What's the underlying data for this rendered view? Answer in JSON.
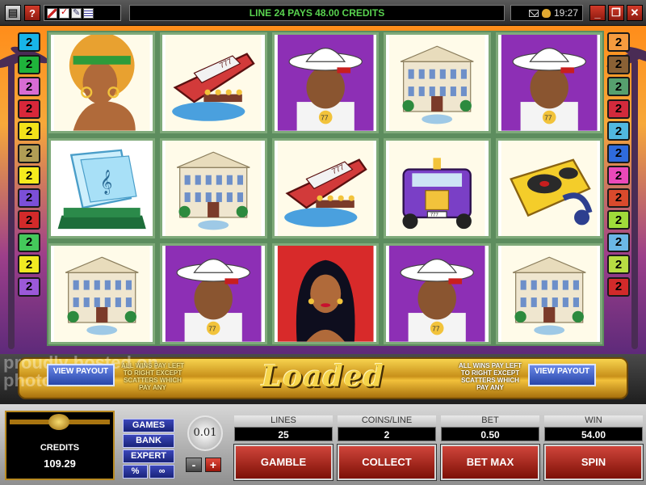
{
  "topbar": {
    "message": "LINE 24 PAYS 48.00 CREDITS",
    "time": "19:27",
    "help_label": "?"
  },
  "lines": {
    "left": [
      {
        "label": "2",
        "color": "#18b4e8"
      },
      {
        "label": "2",
        "color": "#1fb33b"
      },
      {
        "label": "2",
        "color": "#d86cd3"
      },
      {
        "label": "2",
        "color": "#d8273a"
      },
      {
        "label": "2",
        "color": "#f3e21a"
      },
      {
        "label": "2",
        "color": "#b19d55"
      },
      {
        "label": "2",
        "color": "#f6ec1d"
      },
      {
        "label": "2",
        "color": "#7b4fd8"
      },
      {
        "label": "2",
        "color": "#d22a2a"
      },
      {
        "label": "2",
        "color": "#44c95b"
      },
      {
        "label": "2",
        "color": "#f0ea22"
      },
      {
        "label": "2",
        "color": "#9b59d8"
      }
    ],
    "right": [
      {
        "label": "2",
        "color": "#f59b3e"
      },
      {
        "label": "2",
        "color": "#8a6135"
      },
      {
        "label": "2",
        "color": "#56a06e"
      },
      {
        "label": "2",
        "color": "#d22a3c"
      },
      {
        "label": "2",
        "color": "#50b8e0"
      },
      {
        "label": "2",
        "color": "#2f6bdc"
      },
      {
        "label": "2",
        "color": "#eb49b9"
      },
      {
        "label": "2",
        "color": "#d94a2c"
      },
      {
        "label": "2",
        "color": "#9fdc3a"
      },
      {
        "label": "2",
        "color": "#6bb7e6"
      },
      {
        "label": "2",
        "color": "#b8dd43"
      },
      {
        "label": "2",
        "color": "#d22a2a"
      }
    ]
  },
  "reels": [
    [
      "woman-afro",
      "music-award",
      "mansion"
    ],
    [
      "yacht",
      "mansion",
      "rapper-white-hat"
    ],
    [
      "rapper-white-hat",
      "yacht",
      "diva"
    ],
    [
      "mansion",
      "purple-limo",
      "rapper-white-hat"
    ],
    [
      "rapper-white-hat",
      "dj-turntable",
      "mansion"
    ]
  ],
  "banner": {
    "logo": "Loaded",
    "payinfo_right": "ALL WINS PAY LEFT TO RIGHT EXCEPT SCATTERS WHICH PAY ANY",
    "view_payout": "VIEW PAYOUT",
    "watermark": "proudly hosted on photobucket"
  },
  "panel": {
    "credits_label": "CREDITS",
    "credits_value": "109.29",
    "menu": {
      "games": "GAMES",
      "bank": "BANK",
      "expert": "EXPERT",
      "percent": "%",
      "autoplay": "∞"
    },
    "coin_value": "0.01",
    "minus": "-",
    "plus": "+",
    "lines_label": "LINES",
    "lines_value": "25",
    "coins_label": "COINS/LINE",
    "coins_value": "2",
    "bet_label": "BET",
    "bet_value": "0.50",
    "win_label": "WIN",
    "win_value": "54.00",
    "gamble": "GAMBLE",
    "collect": "COLLECT",
    "bet_max": "BET MAX",
    "spin": "SPIN"
  }
}
